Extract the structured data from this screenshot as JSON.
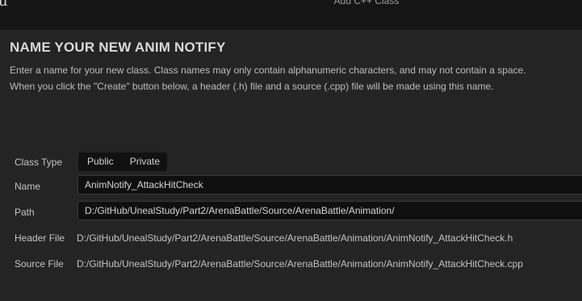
{
  "window": {
    "title": "Add C++ Class",
    "logo_icon": "unreal-logo-icon"
  },
  "page": {
    "heading": "NAME YOUR NEW ANIM NOTIFY",
    "description_line1": "Enter a name for your new class. Class names may only contain alphanumeric characters, and may not contain a space.",
    "description_line2": "When you click the \"Create\" button below, a header (.h) file and a source (.cpp) file will be made using this name."
  },
  "form": {
    "class_type": {
      "label": "Class Type",
      "options": [
        "Public",
        "Private"
      ]
    },
    "name": {
      "label": "Name",
      "value": "AnimNotify_AttackHitCheck"
    },
    "path": {
      "label": "Path",
      "value": "D:/GitHub/UnealStudy/Part2/ArenaBattle/Source/ArenaBattle/Animation/"
    },
    "header_file": {
      "label": "Header File",
      "value": "D:/GitHub/UnealStudy/Part2/ArenaBattle/Source/ArenaBattle/Animation/AnimNotify_AttackHitCheck.h"
    },
    "source_file": {
      "label": "Source File",
      "value": "D:/GitHub/UnealStudy/Part2/ArenaBattle/Source/ArenaBattle/Animation/AnimNotify_AttackHitCheck.cpp"
    }
  },
  "colors": {
    "background": "#1b1b1b",
    "panel": "#242424",
    "input": "#0f0f0f"
  }
}
